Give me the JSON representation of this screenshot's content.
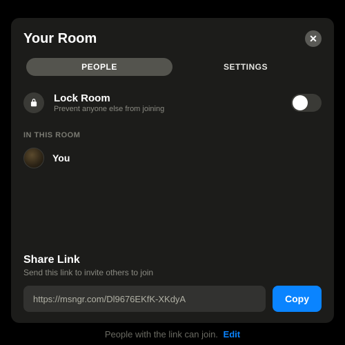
{
  "modal": {
    "title": "Your Room",
    "close_glyph": "✕"
  },
  "tabs": {
    "people": "PEOPLE",
    "settings": "SETTINGS"
  },
  "lock": {
    "title": "Lock Room",
    "subtitle": "Prevent anyone else from joining",
    "enabled": false
  },
  "section": {
    "in_this_room": "IN THIS ROOM"
  },
  "participants": [
    {
      "name": "You"
    }
  ],
  "share": {
    "title": "Share Link",
    "subtitle": "Send this link to invite others to join",
    "url": "https://msngr.com/Dl9676EKfK-XKdyA",
    "copy_label": "Copy"
  },
  "footer": {
    "text": "People with the link can join.",
    "edit_label": "Edit"
  },
  "colors": {
    "accent": "#0a84ff",
    "modal_bg": "#1c1c1a"
  }
}
